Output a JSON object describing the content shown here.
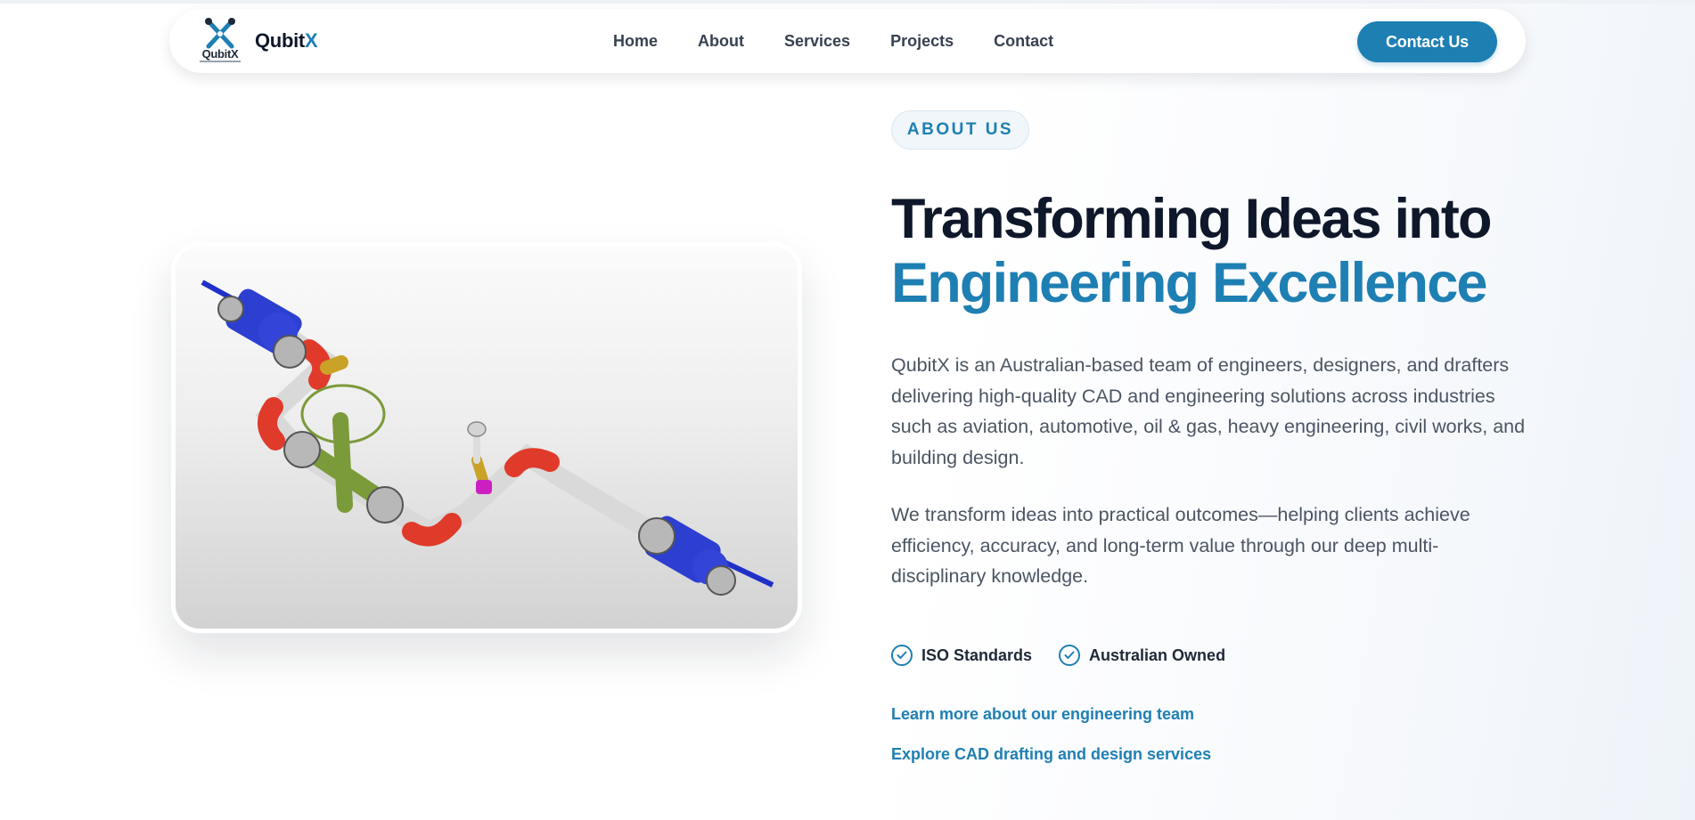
{
  "brand": {
    "logo_text": "QubitX",
    "name_prefix": "Qubit",
    "name_suffix": "X"
  },
  "nav": {
    "items": [
      "Home",
      "About",
      "Services",
      "Projects",
      "Contact"
    ],
    "cta_label": "Contact Us"
  },
  "about": {
    "badge": "ABOUT US",
    "heading_line1": "Transforming Ideas into",
    "heading_line2": "Engineering Excellence",
    "paragraph1": "QubitX is an Australian-based team of engineers, designers, and drafters delivering high-quality CAD and engineering solutions across industries such as aviation, automotive, oil & gas, heavy engineering, civil works, and building design.",
    "paragraph2": "We transform ideas into practical outcomes—helping clients achieve efficiency, accuracy, and long-term value through our deep multi-disciplinary knowledge.",
    "features": [
      "ISO Standards",
      "Australian Owned"
    ],
    "link1": "Learn more about our engineering team",
    "link2": "Explore CAD drafting and design services"
  },
  "colors": {
    "accent": "#1e7fb3",
    "heading": "#0f172a",
    "body_text": "#4b5563"
  },
  "icons": {
    "logo": "qubitx-x-logo-icon",
    "feature": "check-circle-icon",
    "hero_image": "pipeline-cad-render"
  }
}
